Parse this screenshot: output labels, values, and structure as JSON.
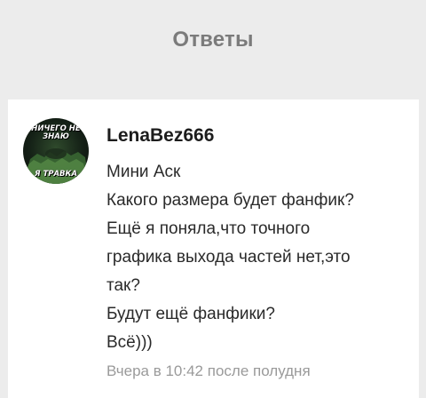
{
  "header": {
    "title": "Ответы"
  },
  "answer": {
    "avatar_text_top": "НИЧЕГО НЕ ЗНАЮ",
    "avatar_text_bottom": "Я ТРАВКА",
    "author": "LenaBez666",
    "message_lines": [
      "Мини Аск",
      "Какого размера будет фанфик?",
      "Ещё я поняла,что точного",
      "графика выхода частей нет,это",
      "так?",
      "Будут ещё фанфики?",
      "Всё)))"
    ],
    "timestamp": "Вчера в 10:42 после полудня"
  }
}
